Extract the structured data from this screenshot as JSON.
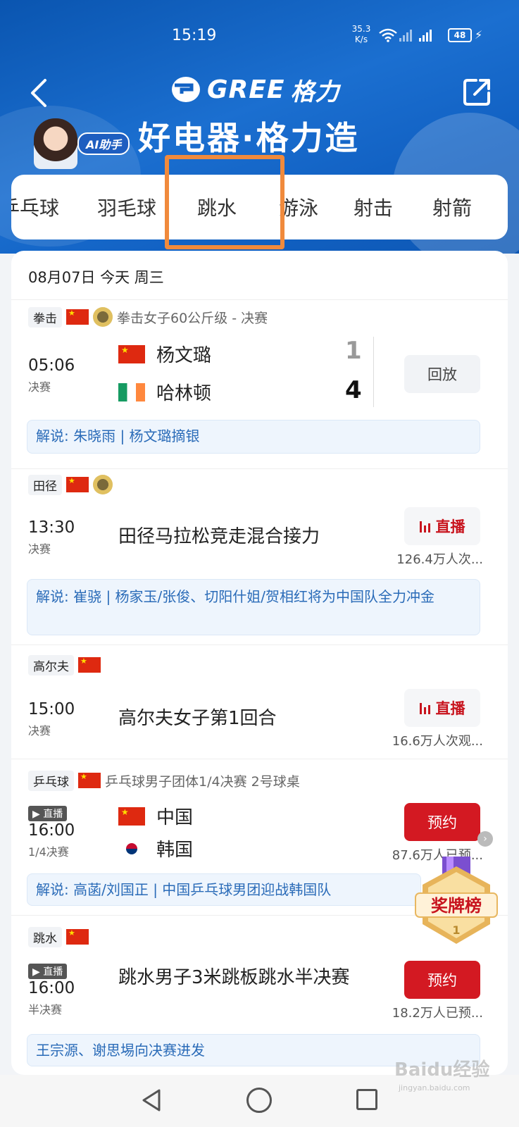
{
  "status_bar": {
    "time": "15:19",
    "net_speed_value": "35.3",
    "net_speed_unit": "K/s",
    "battery": "48"
  },
  "header": {
    "brand": "GREE",
    "brand_cn": "格力",
    "slogan": "好电器·格力造",
    "ai_label": "AI助手"
  },
  "tabs": [
    "乒乓球",
    "羽毛球",
    "跳水",
    "游泳",
    "射击",
    "射箭"
  ],
  "active_tab": "跳水",
  "date_row": "08月07日 今天 周三",
  "events": [
    {
      "sport": "拳击",
      "desc": "拳击女子60公斤级 - 决赛",
      "time": "05:06",
      "stage": "决赛",
      "teams": [
        {
          "name": "杨文璐",
          "score": "1"
        },
        {
          "name": "哈林顿",
          "score": "4"
        }
      ],
      "button": "回放",
      "commentary": "解说: 朱晓雨 | 杨文璐摘银"
    },
    {
      "sport": "田径",
      "time": "13:30",
      "stage": "决赛",
      "title": "田径马拉松竞走混合接力",
      "button": "直播",
      "count": "126.4万人次...",
      "commentary": "解说: 崔骁 | 杨家玉/张俊、切阳什姐/贺相红将为中国队全力冲金"
    },
    {
      "sport": "高尔夫",
      "time": "15:00",
      "stage": "决赛",
      "title": "高尔夫女子第1回合",
      "button": "直播",
      "count": "16.6万人次观..."
    },
    {
      "sport": "乒乓球",
      "desc": "乒乓球男子团体1/4决赛 2号球桌",
      "live_badge": "直播",
      "time": "16:00",
      "stage": "1/4决赛",
      "teams": [
        {
          "name": "中国"
        },
        {
          "name": "韩国"
        }
      ],
      "button": "预约",
      "count": "87.6万人已预...",
      "commentary": "解说: 高菡/刘国正 | 中国乒乓球男团迎战韩国队"
    },
    {
      "sport": "跳水",
      "live_badge": "直播",
      "time": "16:00",
      "stage": "半决赛",
      "title": "跳水男子3米跳板跳水半决赛",
      "button": "预约",
      "count": "18.2万人已预...",
      "commentary": "王宗源、谢思埸向决赛进发"
    }
  ],
  "medal_badge": {
    "label": "奖牌榜",
    "rank": "1"
  },
  "watermark": {
    "main": "Baidu经验",
    "sub": "jingyan.baidu.com"
  },
  "colors": {
    "header_blue": "#0d5ab6",
    "live_red": "#c8141e",
    "reserve_red": "#d31922",
    "highlight_orange": "#f08a3c",
    "commentary_blue": "#2a6bb8"
  }
}
